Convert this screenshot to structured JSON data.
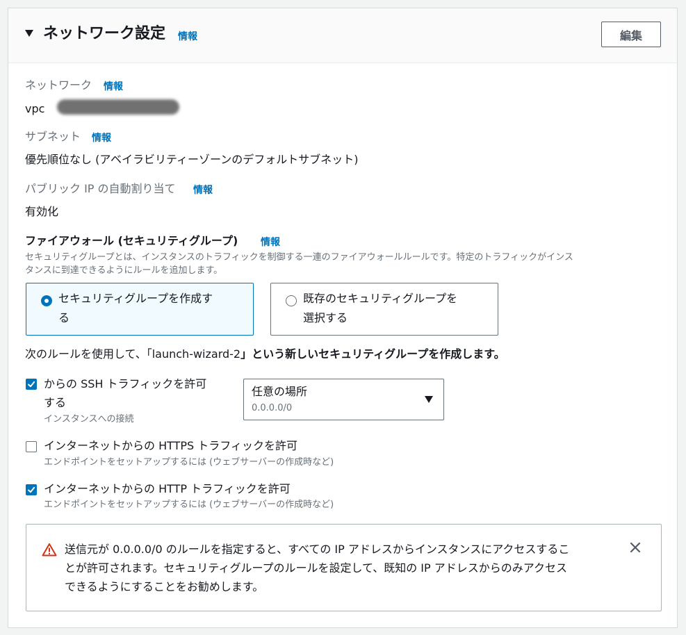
{
  "header": {
    "title": "ネットワーク設定",
    "info": "情報",
    "edit_label": "編集"
  },
  "network": {
    "label": "ネットワーク",
    "info": "情報",
    "value": "vpc"
  },
  "subnet": {
    "label": "サブネット",
    "info": "情報",
    "value": "優先順位なし (アベイラビリティーゾーンのデフォルトサブネット)"
  },
  "public_ip": {
    "label": "パブリック IP の自動割り当て",
    "info": "情報",
    "value": "有効化"
  },
  "firewall": {
    "title": "ファイアウォール (セキュリティグループ)",
    "info": "情報",
    "description_line1": "セキュリティグループとは、インスタンスのトラフィックを制御する一連のファイアウォールルールです。特定のトラフィックがインス",
    "description_line2": "タンスに到達できるようにルールを追加します。",
    "options": [
      {
        "line1": "セキュリティグループを作成す",
        "line2": "る",
        "selected": true
      },
      {
        "line1": "既存のセキュリティグループを",
        "line2": "選択する",
        "selected": false
      }
    ],
    "notice_prefix": "次のルールを使用して、「launch-wizard-2",
    "notice_suffix": "」という新しいセキュリティグループを作成します。"
  },
  "rules": {
    "ssh": {
      "label_line1": "からの SSH トラフィックを許可",
      "label_line2": "する",
      "description": "インスタンスへの接続",
      "checked": true
    },
    "ssh_source": {
      "value": "任意の場所",
      "sub": "0.0.0.0/0"
    },
    "https": {
      "label": "インターネットからの HTTPS トラフィックを許可",
      "description": "エンドポイントをセットアップするには (ウェブサーバーの作成時など)",
      "checked": false
    },
    "http": {
      "label": "インターネットからの HTTP トラフィックを許可",
      "description": "エンドポイントをセットアップするには (ウェブサーバーの作成時など)",
      "checked": true
    }
  },
  "alert": {
    "line1": "送信元が 0.0.0.0/0 のルールを指定すると、すべての IP アドレスからインスタンスにアクセスするこ",
    "line2": "とが許可されます。セキュリティグループのルールを設定して、既知の IP アドレスからのみアクセス",
    "line3": "できるようにすることをお勧めします。"
  },
  "colors": {
    "accent": "#0073bb",
    "warning": "#d13212"
  }
}
